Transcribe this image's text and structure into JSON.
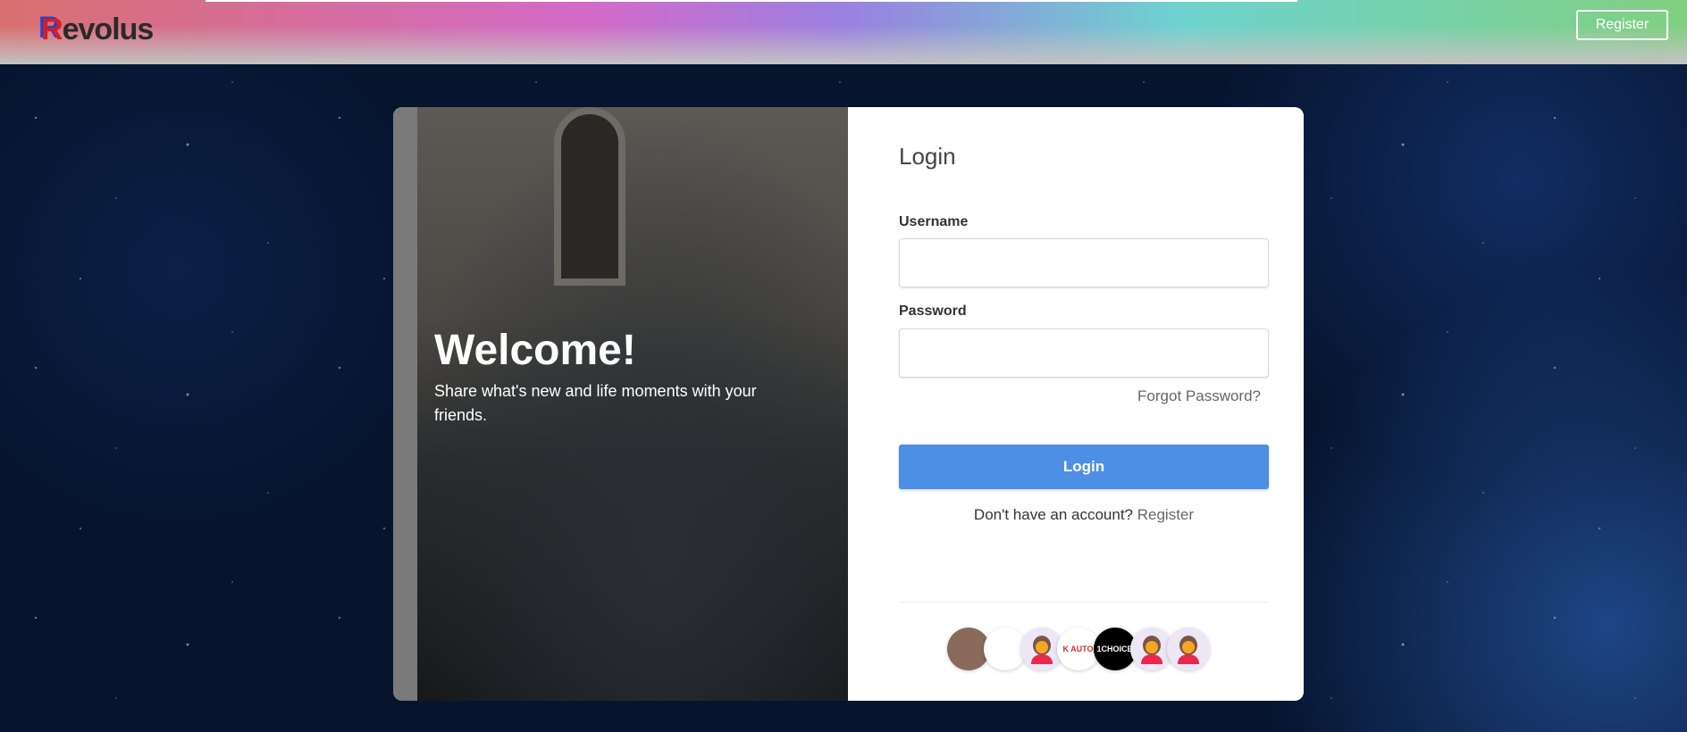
{
  "header": {
    "brand": "Revolus",
    "register_label": "Register"
  },
  "hero": {
    "title": "Welcome!",
    "subtitle": "Share what's new and life moments with your friends."
  },
  "login": {
    "title": "Login",
    "username_label": "Username",
    "username_value": "",
    "password_label": "Password",
    "password_value": "",
    "forgot": "Forgot Password?",
    "button": "Login",
    "no_account": "Don't have an account?",
    "register_link": "Register"
  },
  "avatars": [
    {
      "name": "user-photo-1",
      "bg": "#8a6a5a",
      "text": ""
    },
    {
      "name": "luggage-logo",
      "bg": "#ffffff",
      "text": ""
    },
    {
      "name": "default-avatar",
      "bg": "#ece6f5",
      "text": ""
    },
    {
      "name": "karl-automotive-logo",
      "bg": "#ffffff",
      "text": "K AUTO"
    },
    {
      "name": "1st-choice-logo",
      "bg": "#000000",
      "text": "1CHOICE"
    },
    {
      "name": "default-avatar",
      "bg": "#ece6f5",
      "text": ""
    },
    {
      "name": "default-avatar",
      "bg": "#ece6f5",
      "text": ""
    }
  ]
}
